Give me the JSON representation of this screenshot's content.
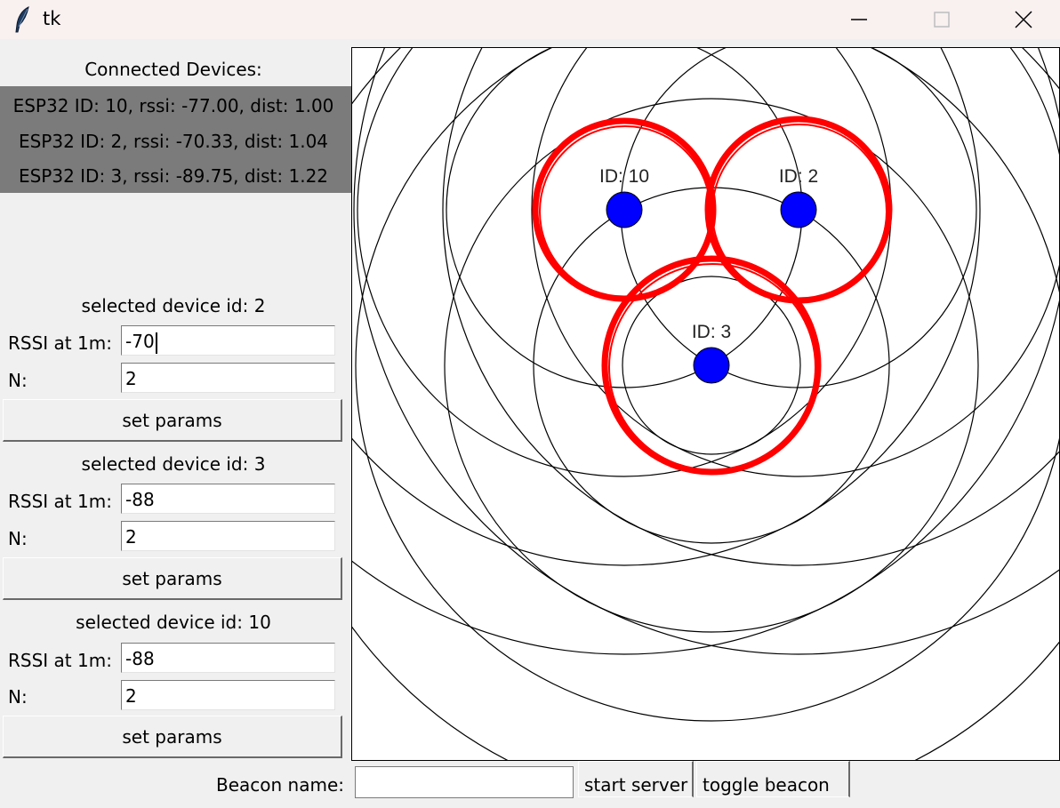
{
  "window": {
    "title": "tk"
  },
  "sidebar": {
    "header": "Connected Devices:",
    "devices": [
      "ESP32 ID: 10, rssi: -77.00, dist: 1.00",
      "ESP32 ID: 2, rssi: -70.33, dist: 1.04",
      "ESP32 ID: 3, rssi: -89.75, dist: 1.22"
    ],
    "param_panels": [
      {
        "title": "selected device id: 2",
        "rssi_label": "RSSI at 1m:",
        "rssi_value": "-70",
        "n_label": "N:",
        "n_value": "2",
        "button": "set params"
      },
      {
        "title": "selected device id: 3",
        "rssi_label": "RSSI at 1m:",
        "rssi_value": "-88",
        "n_label": "N:",
        "n_value": "2",
        "button": "set params"
      },
      {
        "title": "selected device id: 10",
        "rssi_label": "RSSI at 1m:",
        "rssi_value": "-88",
        "n_label": "N:",
        "n_value": "2",
        "button": "set params"
      }
    ]
  },
  "canvas": {
    "beacons": [
      {
        "label": "ID: 10",
        "color": "#0000ff",
        "range_color": "#ff0000"
      },
      {
        "label": "ID: 2",
        "color": "#0000ff",
        "range_color": "#ff0000"
      },
      {
        "label": "ID: 3",
        "color": "#0000ff",
        "range_color": "#ff0000"
      }
    ]
  },
  "bottom": {
    "beacon_label": "Beacon name:",
    "beacon_value": "",
    "start_server": "start server",
    "toggle_beacon": "toggle beacon"
  }
}
